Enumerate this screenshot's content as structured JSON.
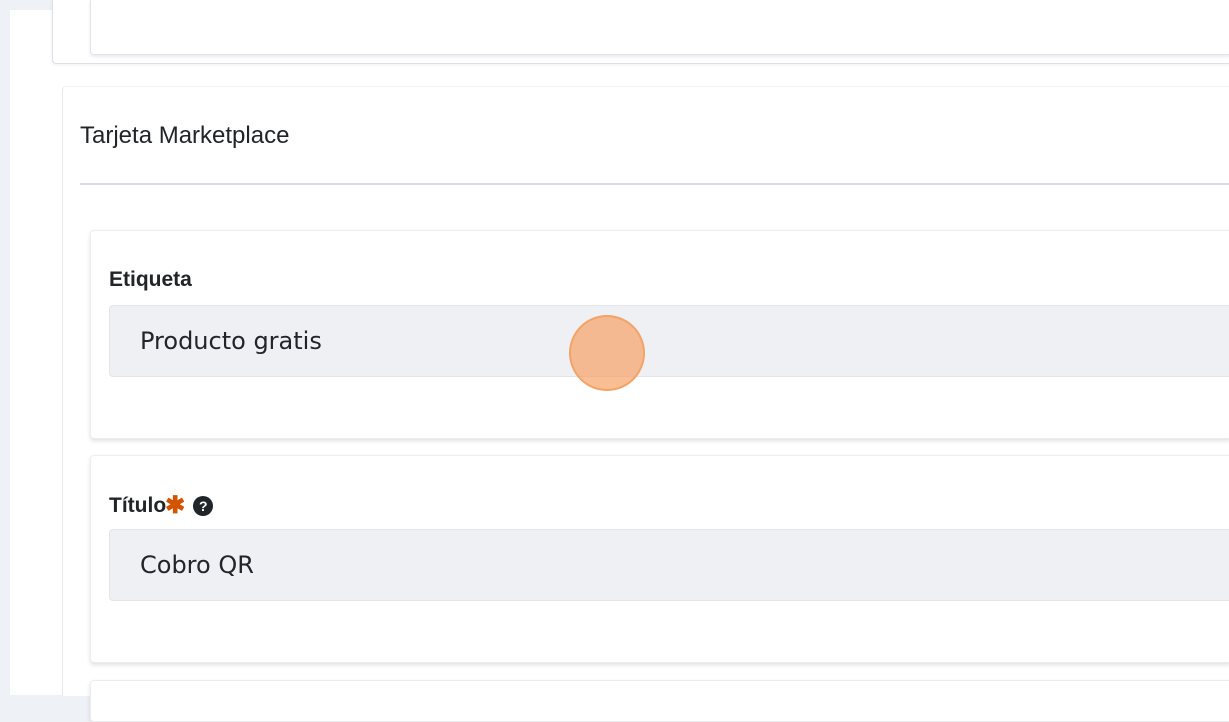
{
  "section": {
    "title": "Tarjeta Marketplace"
  },
  "fields": {
    "etiqueta": {
      "label": "Etiqueta",
      "value": "Producto gratis"
    },
    "titulo": {
      "label": "Título",
      "required_symbol": "✱",
      "help_symbol": "?",
      "value": "Cobro QR"
    }
  },
  "icons": {
    "required": "asterisk-icon",
    "help": "question-circle-icon"
  },
  "colors": {
    "required": "#d35400",
    "input_background": "#eef0f4",
    "click_marker": "#f79b5c"
  }
}
